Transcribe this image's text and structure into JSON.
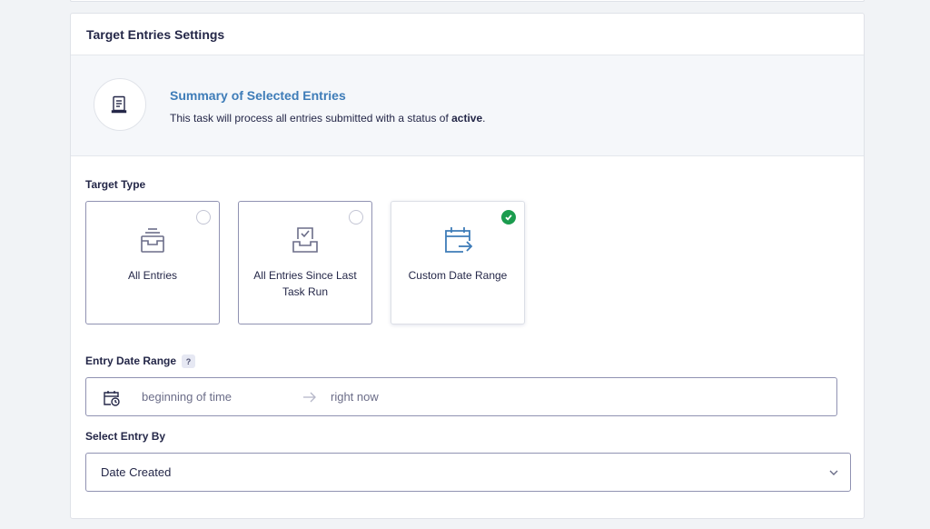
{
  "panel": {
    "title": "Target Entries Settings"
  },
  "summary": {
    "icon": "document-list-icon",
    "title": "Summary of Selected Entries",
    "text_prefix": "This task will process all entries submitted with a status of ",
    "status": "active",
    "text_suffix": "."
  },
  "target_type": {
    "label": "Target Type",
    "options": [
      {
        "label": "All Entries",
        "icon": "inbox-tray-icon",
        "selected": false
      },
      {
        "label": "All Entries Since Last Task Run",
        "icon": "inbox-check-icon",
        "selected": false
      },
      {
        "label": "Custom Date Range",
        "icon": "calendar-arrow-icon",
        "selected": true
      }
    ]
  },
  "date_range": {
    "label": "Entry Date Range",
    "help": "?",
    "start_placeholder": "beginning of time",
    "end_placeholder": "right now"
  },
  "select_entry_by": {
    "label": "Select Entry By",
    "value": "Date Created"
  },
  "colors": {
    "accent": "#3e7cb8",
    "success": "#1b9c4e",
    "text": "#242748",
    "border": "#9092b2"
  }
}
